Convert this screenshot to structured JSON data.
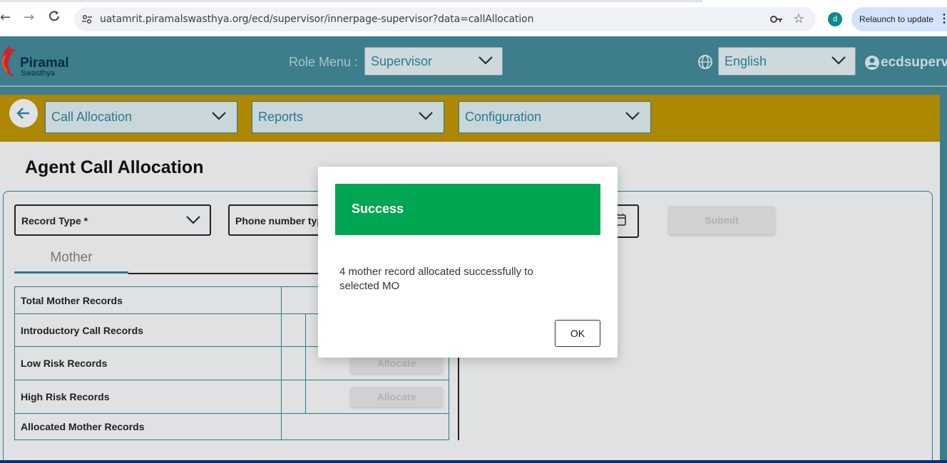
{
  "browser": {
    "url": "uatamrit.piramalswasthya.org/ecd/supervisor/innerpage-supervisor?data=callAllocation",
    "profile_initial": "d",
    "relaunch_label": "Relaunch to update",
    "back_glyph": "←",
    "forward_glyph": "→",
    "reload_glyph": "C",
    "site_icon": "tune-icon",
    "key_icon": "key-icon",
    "star_icon": "star-icon"
  },
  "header": {
    "logo_name": "Piramal",
    "logo_sub": "Swasthya",
    "role_menu_label": "Role Menu :",
    "role_value": "Supervisor",
    "language_value": "English",
    "username": "ecdsupervis",
    "colors": {
      "header_bg": "#3d7d8c",
      "gold_bar": "#ad8800",
      "accent": "#2a7a8f"
    }
  },
  "nav": {
    "menus": [
      "Call Allocation",
      "Reports",
      "Configuration"
    ]
  },
  "main": {
    "title": "Agent Call Allocation",
    "record_type_label": "Record Type *",
    "phone_type_label": "Phone number type",
    "submit_label": "Submit",
    "tab_mother": "Mother",
    "rows": [
      {
        "label": "Total Mother Records"
      },
      {
        "label": "Introductory Call Records"
      },
      {
        "label": "Low Risk Records",
        "button": "Allocate"
      },
      {
        "label": "High Risk Records",
        "button": "Allocate"
      },
      {
        "label": "Allocated Mother Records"
      }
    ]
  },
  "modal": {
    "title": "Success",
    "message": "4 mother record allocated successfully to selected MO",
    "ok_label": "OK",
    "header_color": "#00a651"
  }
}
